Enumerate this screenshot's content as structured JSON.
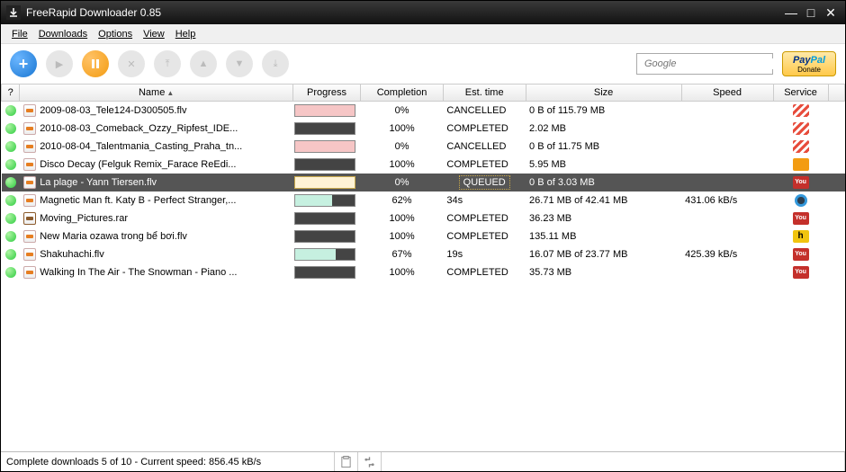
{
  "app": {
    "title": "FreeRapid Downloader 0.85"
  },
  "menu": {
    "file": "File",
    "downloads": "Downloads",
    "options": "Options",
    "view": "View",
    "help": "Help"
  },
  "toolbar": {
    "add": "+",
    "search_placeholder": "Google",
    "donate_brand": "PayPal",
    "donate_label": "Donate"
  },
  "columns": {
    "q": "?",
    "name": "Name",
    "progress": "Progress",
    "completion": "Completion",
    "est": "Est. time",
    "size": "Size",
    "speed": "Speed",
    "service": "Service"
  },
  "rows": [
    {
      "name": "2009-08-03_Tele124-D300505.flv",
      "ptype": "cancel",
      "pfill": 100,
      "completion": "0%",
      "est": "CANCELLED",
      "size": "0 B of 115.79 MB",
      "speed": "",
      "svc": "red",
      "ft": "vid"
    },
    {
      "name": "2010-08-03_Comeback_Ozzy_Ripfest_IDE...",
      "ptype": "done",
      "pfill": 100,
      "completion": "100%",
      "est": "COMPLETED",
      "size": "2.02 MB",
      "speed": "",
      "svc": "red",
      "ft": "vid"
    },
    {
      "name": "2010-08-04_Talentmania_Casting_Praha_tn...",
      "ptype": "cancel",
      "pfill": 100,
      "completion": "0%",
      "est": "CANCELLED",
      "size": "0 B of 11.75 MB",
      "speed": "",
      "svc": "red",
      "ft": "vid"
    },
    {
      "name": "Disco Decay (Felguk Remix_Farace ReEdi...",
      "ptype": "done",
      "pfill": 100,
      "completion": "100%",
      "est": "COMPLETED",
      "size": "5.95 MB",
      "speed": "",
      "svc": "orange",
      "ft": "vid"
    },
    {
      "name": "La plage - Yann Tiersen.flv",
      "ptype": "queued",
      "pfill": 0,
      "completion": "0%",
      "est": "QUEUED",
      "size": "0 B of 3.03 MB",
      "speed": "",
      "svc": "yt",
      "ft": "vid",
      "selected": true
    },
    {
      "name": "Magnetic Man ft. Katy B - Perfect Stranger,...",
      "ptype": "active",
      "pfill": 62,
      "completion": "62%",
      "est": "34s",
      "size": "26.71 MB of 42.41 MB",
      "speed": "431.06 kB/s",
      "svc": "blue",
      "ft": "vid"
    },
    {
      "name": "Moving_Pictures.rar",
      "ptype": "done",
      "pfill": 100,
      "completion": "100%",
      "est": "COMPLETED",
      "size": "36.23 MB",
      "speed": "",
      "svc": "yt",
      "ft": "rar"
    },
    {
      "name": "New Maria ozawa trong bể bơi.flv",
      "ptype": "done",
      "pfill": 100,
      "completion": "100%",
      "est": "COMPLETED",
      "size": "135.11 MB",
      "speed": "",
      "svc": "h",
      "ft": "vid"
    },
    {
      "name": "Shakuhachi.flv",
      "ptype": "active",
      "pfill": 67,
      "completion": "67%",
      "est": "19s",
      "size": "16.07 MB of 23.77 MB",
      "speed": "425.39 kB/s",
      "svc": "yt",
      "ft": "vid"
    },
    {
      "name": "Walking In The Air - The Snowman - Piano ...",
      "ptype": "done",
      "pfill": 100,
      "completion": "100%",
      "est": "COMPLETED",
      "size": "35.73 MB",
      "speed": "",
      "svc": "yt",
      "ft": "vid"
    }
  ],
  "status": {
    "text": "Complete downloads 5 of 10 - Current speed: 856.45 kB/s"
  }
}
